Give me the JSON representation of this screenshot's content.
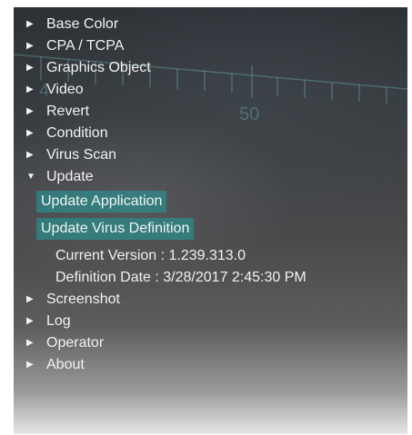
{
  "menu": {
    "items": [
      {
        "label": "Base Color",
        "arrow": "▶"
      },
      {
        "label": "CPA / TCPA",
        "arrow": "▶"
      },
      {
        "label": "Graphics Object",
        "arrow": "▶"
      },
      {
        "label": "Video",
        "arrow": "▶"
      },
      {
        "label": "Revert",
        "arrow": "▶"
      },
      {
        "label": "Condition",
        "arrow": "▶"
      },
      {
        "label": "Virus Scan",
        "arrow": "▶"
      },
      {
        "label": "Update",
        "arrow": "▼"
      },
      {
        "label": "Screenshot",
        "arrow": "▶"
      },
      {
        "label": "Log",
        "arrow": "▶"
      },
      {
        "label": "Operator",
        "arrow": "▶"
      },
      {
        "label": "About",
        "arrow": "▶"
      }
    ]
  },
  "update": {
    "update_application_label": "Update Application",
    "update_virus_definition_label": "Update Virus Definition",
    "current_version": "Current Version : 1.239.313.0",
    "definition_date": "Definition Date : 3/28/2017 2:45:30 PM"
  },
  "background": {
    "scale_label_left": "4",
    "scale_label_mid": "50",
    "scale_color": "#78bebe"
  }
}
